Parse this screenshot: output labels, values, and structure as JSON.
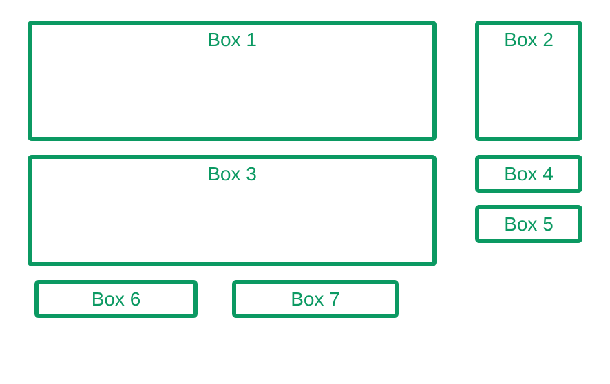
{
  "boxes": {
    "box1": {
      "label": "Box 1"
    },
    "box2": {
      "label": "Box 2"
    },
    "box3": {
      "label": "Box 3"
    },
    "box4": {
      "label": "Box 4"
    },
    "box5": {
      "label": "Box 5"
    },
    "box6": {
      "label": "Box 6"
    },
    "box7": {
      "label": "Box 7"
    }
  },
  "style": {
    "borderColor": "#0B9962",
    "textColor": "#0B9962"
  }
}
